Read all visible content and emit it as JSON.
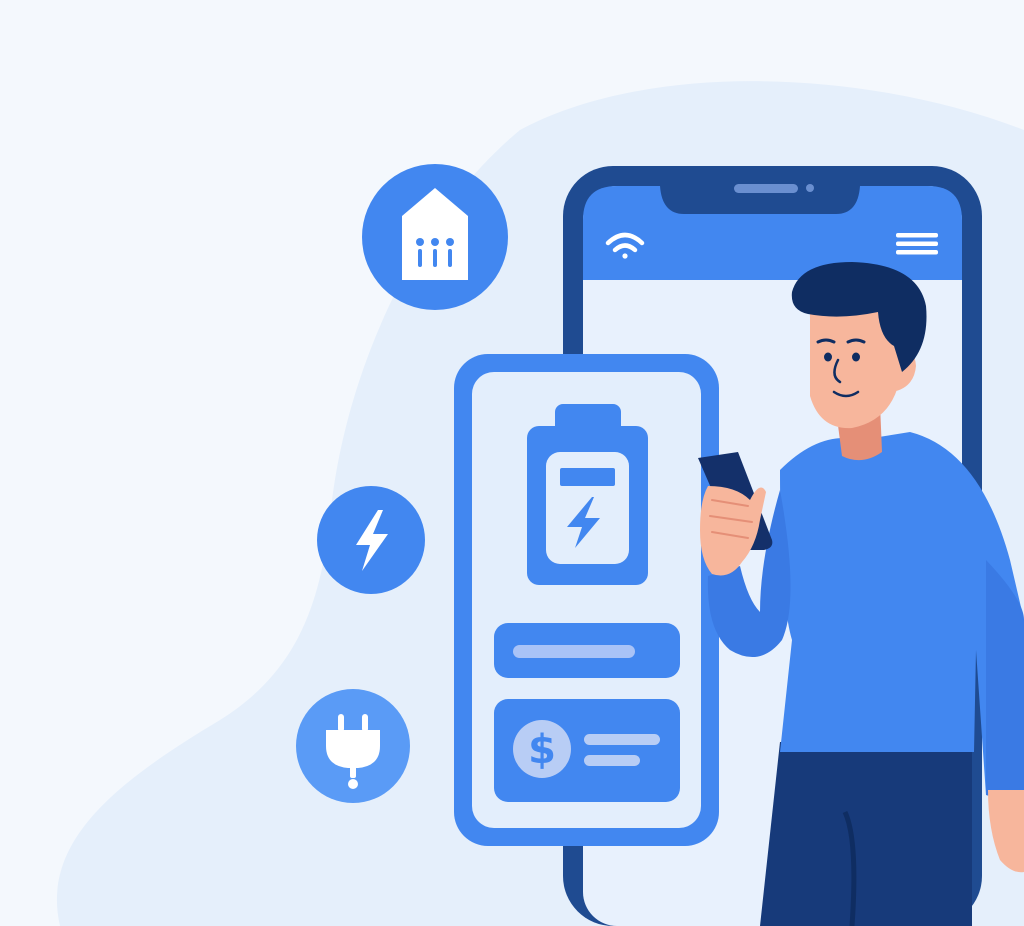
{
  "colors": {
    "background": "#f4f8fd",
    "blob": "#e5effb",
    "device_frame": "#1f4b91",
    "screen_bg": "#e8f1fd",
    "accent_blue": "#4287f0",
    "light_blue": "#5a9bf6",
    "card_bg": "#e3eefc",
    "hair": "#0f2d62",
    "skin": "#f7b69c",
    "skin_shadow": "#e58f77",
    "pants": "#173a7a",
    "phone_dark": "#14306a",
    "white": "#ffffff",
    "coin": "#b8cdf5",
    "bar_highlight": "#a9c3f7"
  },
  "icons": {
    "smart_home": "house-meter-icon",
    "energy": "lightning-bolt-icon",
    "plug": "power-plug-icon",
    "battery": "battery-charging-icon",
    "wifi": "wifi-icon",
    "menu": "hamburger-menu-icon",
    "currency": "dollar-coin-icon"
  },
  "labels": {
    "dollar_symbol": "$"
  }
}
